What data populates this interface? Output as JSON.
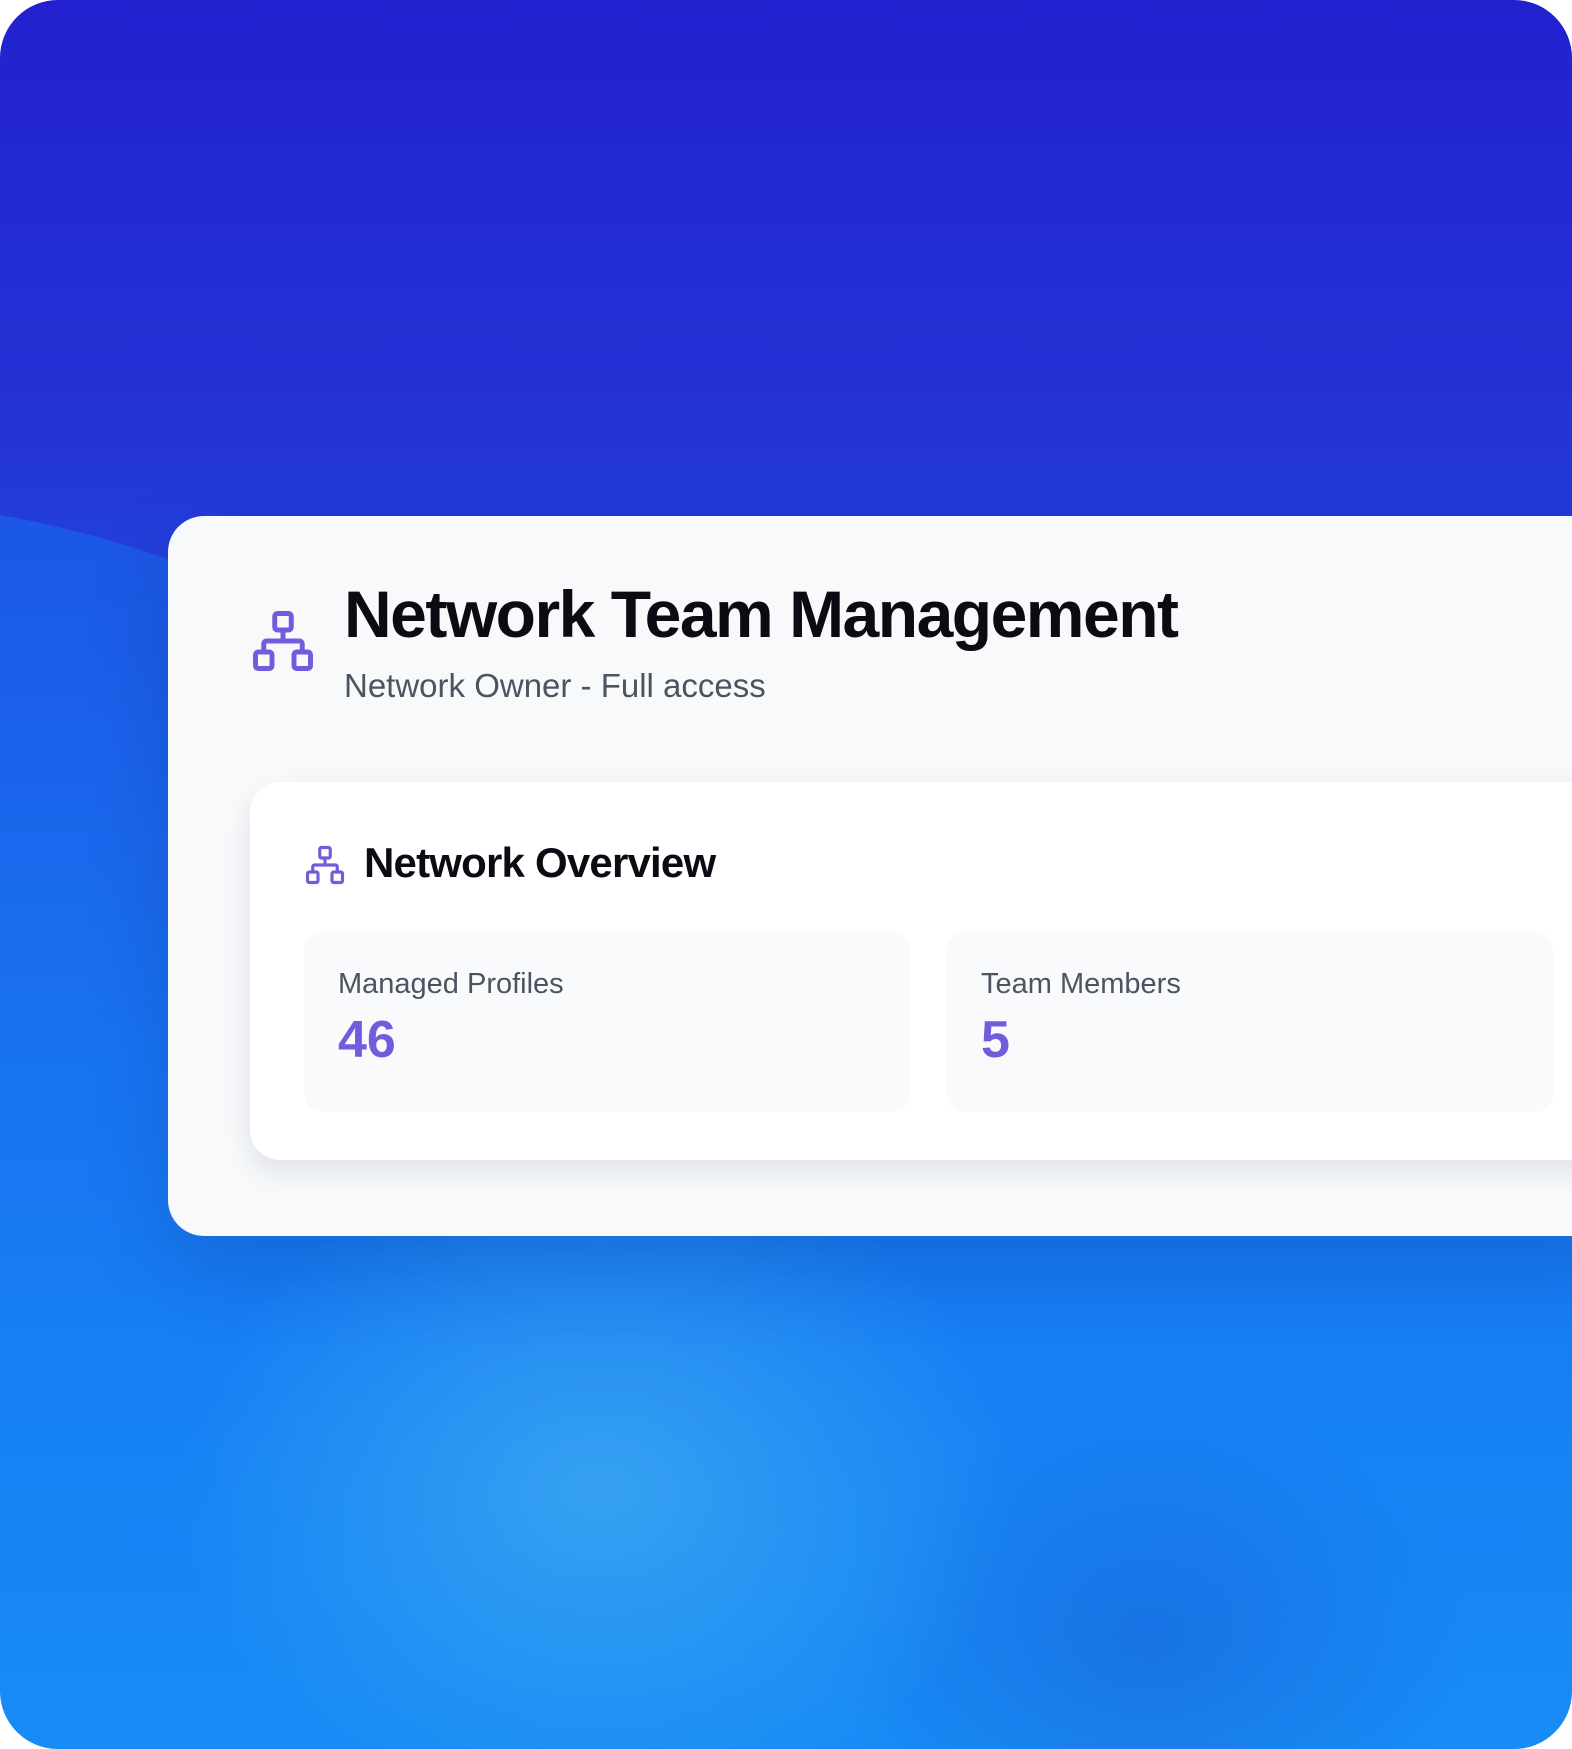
{
  "app": {
    "title": "Network Team Management",
    "subtitle": "Network Owner - Full access",
    "header_icon": "network-hierarchy-icon"
  },
  "overview": {
    "title": "Network Overview",
    "icon": "network-hierarchy-icon",
    "stats": [
      {
        "label": "Managed Profiles",
        "value": "46"
      },
      {
        "label": "Team Members",
        "value": "5"
      }
    ]
  },
  "colors": {
    "accent": "#6f5ddb",
    "icon": "#6f5ddb",
    "heading": "#0b0b14",
    "muted_text": "#4d5360",
    "card_bg": "#f7f9fb",
    "panel_bg": "#ffffff",
    "background_top": "#2321cf",
    "background_bottom": "#1b9df7"
  }
}
